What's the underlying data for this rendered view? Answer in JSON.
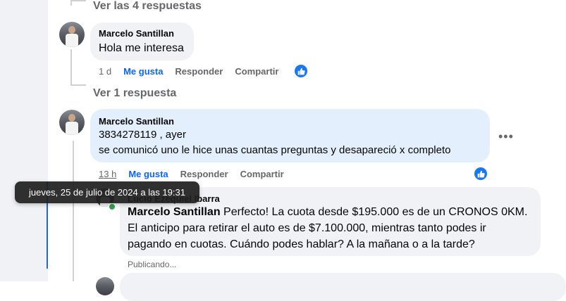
{
  "thread": {
    "view_replies_4": "Ver las 4 respuestas",
    "view_replies_1": "Ver 1 respuesta"
  },
  "comment1": {
    "author": "Marcelo Santillan",
    "text": "Hola me interesa",
    "time": "1 d",
    "like_label": "Me gusta",
    "reply_label": "Responder",
    "share_label": "Compartir"
  },
  "comment2": {
    "author": "Marcelo Santillan",
    "line1": "3834278119 , ayer",
    "line2": "se comunicó uno le hice unas cuantas preguntas y desapareció x completo",
    "time": "13 h",
    "like_label": "Me gusta",
    "reply_label": "Responder",
    "share_label": "Compartir",
    "more": "•••"
  },
  "tooltip": {
    "text": "jueves, 25 de julio de 2024 a las 19:31"
  },
  "reply": {
    "author": "Lucio Ezequiel Ibarra",
    "mention": "Marcelo Santillan",
    "text_first": "Perfecto! La cuota desde $195.000 es de un CRONOS 0KM.",
    "line2": "El anticipo para retirar el auto es de $7.100.000, mientras tanto podes ir",
    "line3": "pagando en cuotas. Cuándo podes hablar? A la mañana o a la tarde?",
    "status": "Publicando..."
  },
  "colors": {
    "accent": "#0866ff",
    "bubble": "#f0f2f5",
    "bubble_highlight": "#e4effd",
    "secondary_text": "#65676b"
  }
}
